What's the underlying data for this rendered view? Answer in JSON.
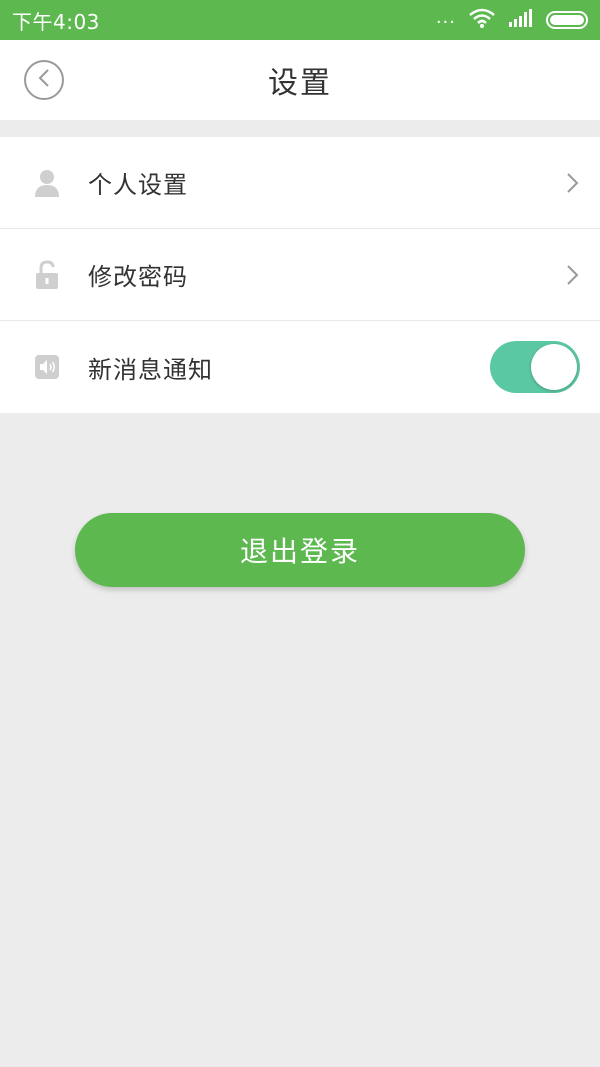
{
  "status_bar": {
    "time": "下午4:03",
    "dots": "...",
    "wifi_icon": "wifi-icon",
    "signal_icon": "signal-icon",
    "battery_icon": "battery-icon"
  },
  "header": {
    "title": "设置",
    "back_icon": "chevron-left-circle-icon"
  },
  "settings": {
    "items": [
      {
        "label": "个人设置",
        "icon": "person-icon",
        "trailing": "chevron-right-icon"
      },
      {
        "label": "修改密码",
        "icon": "lock-icon",
        "trailing": "chevron-right-icon"
      },
      {
        "label": "新消息通知",
        "icon": "speaker-icon",
        "trailing": "toggle",
        "toggle_on": true
      }
    ]
  },
  "actions": {
    "logout_label": "退出登录"
  },
  "colors": {
    "brand_green": "#5cb84f",
    "toggle_on": "#5bc8a4",
    "background": "#ececec",
    "icon_gray": "#cfcfcf",
    "text_dark": "#333333"
  }
}
